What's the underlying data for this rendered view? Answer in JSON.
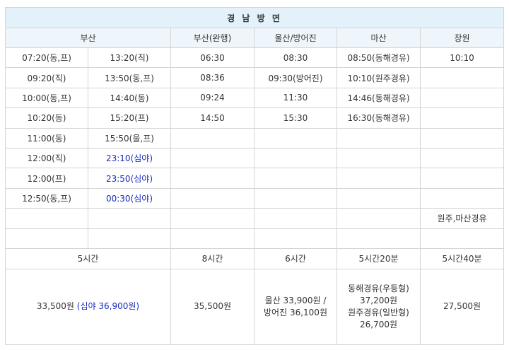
{
  "title": "경 남 방 면",
  "headers": {
    "busan": "부산",
    "busan_wanhaeng": "부산(완행)",
    "ulsan": "울산/방어진",
    "masan": "마산",
    "changwon": "창원"
  },
  "rows": [
    {
      "b1": "07:20(동,프)",
      "b2": "13:20(직)",
      "bw": "06:30",
      "u": "08:30",
      "m": "08:50(동해경유)",
      "c": "10:10"
    },
    {
      "b1": "09:20(직)",
      "b2": "13:50(동,프)",
      "bw": "08:36",
      "u": "09:30(방어진)",
      "m": "10:10(원주경유)",
      "c": ""
    },
    {
      "b1": "10:00(동,프)",
      "b2": "14:40(동)",
      "bw": "09:24",
      "u": "11:30",
      "m": "14:46(동해경유)",
      "c": ""
    },
    {
      "b1": "10:20(동)",
      "b2": "15:20(프)",
      "bw": "14:50",
      "u": "15:30",
      "m": "16:30(동해경유)",
      "c": ""
    },
    {
      "b1": "11:00(동)",
      "b2": "15:50(울,프)",
      "bw": "",
      "u": "",
      "m": "",
      "c": ""
    },
    {
      "b1": "12:00(직)",
      "b2": "23:10(심야)",
      "bw": "",
      "u": "",
      "m": "",
      "c": ""
    },
    {
      "b1": "12:00(프)",
      "b2": "23:50(심야)",
      "bw": "",
      "u": "",
      "m": "",
      "c": ""
    },
    {
      "b1": "12:50(동,프)",
      "b2": "00:30(심야)",
      "bw": "",
      "u": "",
      "m": "",
      "c": ""
    },
    {
      "b1": "",
      "b2": "",
      "bw": "",
      "u": "",
      "m": "",
      "c": "원주,마산경유"
    }
  ],
  "night_color": "#1a2bb8",
  "durations": {
    "busan": "5시간",
    "busan_wanhaeng": "8시간",
    "ulsan": "6시간",
    "masan": "5시간20분",
    "changwon": "5시간40분"
  },
  "prices": {
    "busan_main": "33,500원",
    "busan_night": "(심야 36,900원)",
    "busan_wanhaeng": "35,500원",
    "ulsan_line1": "울산 33,900원 /",
    "ulsan_line2": "방어진 36,100원",
    "masan_line1": "동해경유(우등형)",
    "masan_line2": "37,200원",
    "masan_line3": "원주경유(일반형)",
    "masan_line4": "26,700원",
    "changwon": "27,500원"
  }
}
